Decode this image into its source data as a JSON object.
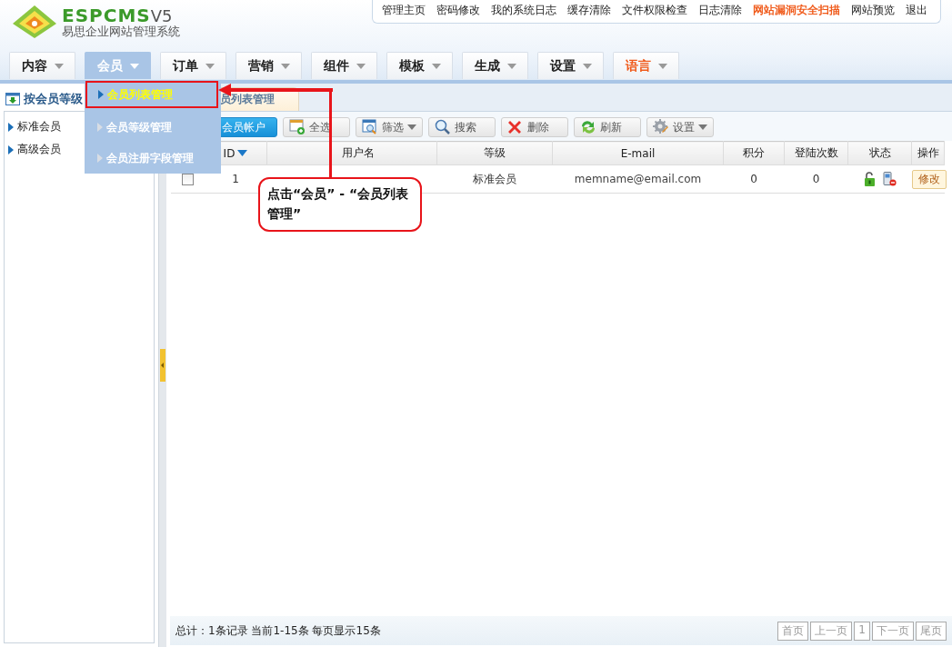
{
  "logo": {
    "brand": "ESPCMS",
    "version": "V5",
    "subtitle": "易思企业网站管理系统"
  },
  "top_links": [
    {
      "label": "管理主页",
      "alert": false
    },
    {
      "label": "密码修改",
      "alert": false
    },
    {
      "label": "我的系统日志",
      "alert": false
    },
    {
      "label": "缓存清除",
      "alert": false
    },
    {
      "label": "文件权限检查",
      "alert": false
    },
    {
      "label": "日志清除",
      "alert": false
    },
    {
      "label": "网站漏洞安全扫描",
      "alert": true
    },
    {
      "label": "网站预览",
      "alert": false
    },
    {
      "label": "退出",
      "alert": false
    }
  ],
  "nav_tabs": [
    {
      "label": "内容",
      "selected": false,
      "alert": false
    },
    {
      "label": "会员",
      "selected": true,
      "alert": false
    },
    {
      "label": "订单",
      "selected": false,
      "alert": false
    },
    {
      "label": "营销",
      "selected": false,
      "alert": false
    },
    {
      "label": "组件",
      "selected": false,
      "alert": false
    },
    {
      "label": "模板",
      "selected": false,
      "alert": false
    },
    {
      "label": "生成",
      "selected": false,
      "alert": false
    },
    {
      "label": "设置",
      "selected": false,
      "alert": false
    },
    {
      "label": "语言",
      "selected": false,
      "alert": true
    }
  ],
  "dropdown": [
    {
      "label": "会员列表管理",
      "selected": true
    },
    {
      "label": "会员等级管理",
      "selected": false
    },
    {
      "label": "会员注册字段管理",
      "selected": false
    }
  ],
  "sidebar": {
    "title": "按会员等级",
    "items": [
      "标准会员",
      "高级会员"
    ]
  },
  "tab": {
    "label": "员列表管理"
  },
  "toolbar": [
    {
      "kind": "primary",
      "label": "会员帐户",
      "caret": false
    },
    {
      "kind": "grid",
      "label": "全选",
      "caret": false
    },
    {
      "kind": "filter",
      "label": "筛选",
      "caret": true
    },
    {
      "kind": "search",
      "label": "搜索",
      "caret": false
    },
    {
      "kind": "delete",
      "label": "删除",
      "caret": false
    },
    {
      "kind": "refresh",
      "label": "刷新",
      "caret": false
    },
    {
      "kind": "settings",
      "label": "设置",
      "caret": true
    }
  ],
  "table": {
    "columns": [
      "ID",
      "用户名",
      "等级",
      "E-mail",
      "积分",
      "登陆次数",
      "状态",
      "操作"
    ],
    "rows": [
      {
        "checked": false,
        "id": "1",
        "level": "标准会员",
        "email": "memname@email.com",
        "points": "0",
        "logins": "0",
        "action": "修改"
      }
    ]
  },
  "callout": "点击“会员” - “会员列表管理”",
  "footer": {
    "summary": "总计：1条记录 当前1-15条 每页显示15条",
    "pager": [
      "首页",
      "上一页",
      "1",
      "下一页",
      "尾页"
    ]
  }
}
